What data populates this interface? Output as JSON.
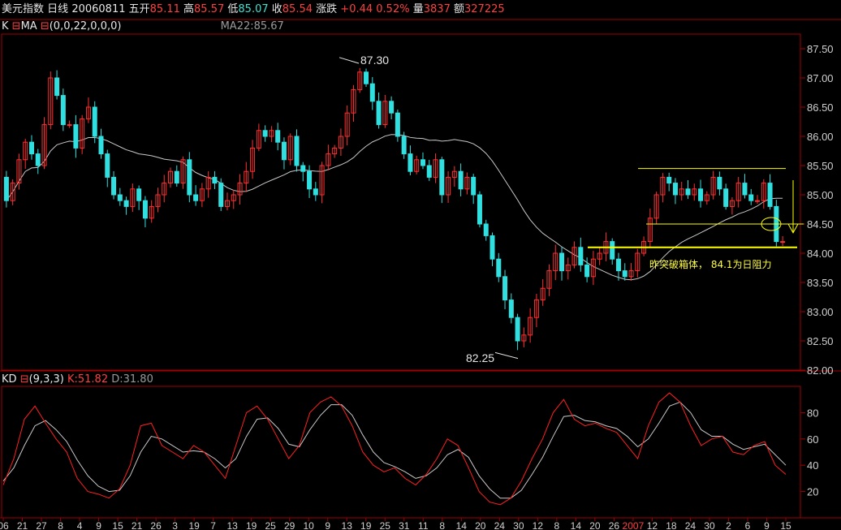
{
  "header": {
    "name": "美元指数",
    "period": "日线",
    "date": "20060811",
    "weekday": "五",
    "open_label": "开",
    "open": "85.11",
    "high_label": "高",
    "high": "85.57",
    "low_label": "低",
    "low": "85.07",
    "close_label": "收",
    "close": "85.54",
    "change_label": "涨跌",
    "change": "+0.44",
    "change_pct": "0.52%",
    "volume_label": "量",
    "volume": "3837",
    "amount_label": "额",
    "amount": "327225"
  },
  "main_panel": {
    "indicator": "K",
    "indicator_marker": "⊟",
    "ma_label": "MA",
    "ma_params": "(0,0,22,0,0,0)",
    "ma_value": "MA22:85.67",
    "y_ticks": [
      "87.50",
      "87.00",
      "86.50",
      "86.00",
      "85.50",
      "85.00",
      "84.50",
      "84.00",
      "83.50",
      "83.00",
      "82.50",
      "82.00"
    ],
    "annotation_high": "87.30",
    "annotation_low": "82.25",
    "annotation_note": "昨突破箱体， 84.1为日阻力",
    "colors": {
      "up": "#ff3030",
      "down": "#30e0e0",
      "ma": "#c8c8c8",
      "line": "#ffff00"
    }
  },
  "kd_panel": {
    "title": "KD",
    "marker": "⊟",
    "params": "(9,3,3)",
    "k_value": "K:51.82",
    "d_value": "D:31.80",
    "y_ticks": [
      "80",
      "60",
      "40",
      "20"
    ]
  },
  "x_axis": {
    "labels": [
      "06",
      "21",
      "27",
      "8",
      "4",
      "9",
      "15",
      "21",
      "26",
      "3",
      "19",
      "7",
      "13",
      "19",
      "25",
      "29",
      "10",
      "9",
      "13",
      "19",
      "25",
      "31",
      "11",
      "8",
      "14",
      "20",
      "24",
      "30",
      "12",
      "8",
      "14",
      "20",
      "26",
      "2007",
      "12",
      "18",
      "24",
      "30",
      "2",
      "6",
      "9",
      "15"
    ]
  },
  "chart_data": {
    "type": "candlestick",
    "ylim": [
      82.0,
      87.75
    ],
    "opens": [
      85.3,
      84.9,
      85.2,
      85.6,
      85.9,
      85.7,
      85.5,
      86.2,
      87.0,
      86.7,
      86.2,
      86.2,
      85.8,
      86.3,
      86.5,
      86.0,
      85.7,
      85.3,
      85.0,
      84.9,
      84.8,
      85.1,
      84.9,
      84.6,
      84.8,
      85.0,
      85.2,
      85.4,
      85.2,
      85.6,
      85.0,
      84.9,
      85.1,
      85.3,
      85.2,
      84.8,
      84.9,
      85.0,
      85.2,
      85.4,
      85.8,
      86.1,
      86.0,
      86.1,
      85.9,
      85.6,
      86.0,
      85.5,
      85.4,
      85.1,
      85.0,
      85.5,
      85.7,
      85.8,
      86.0,
      86.4,
      86.8,
      87.1,
      86.9,
      86.6,
      86.2,
      86.6,
      86.4,
      86.0,
      85.7,
      85.4,
      85.6,
      85.5,
      85.3,
      85.6,
      85.0,
      85.3,
      85.4,
      85.1,
      85.3,
      85.0,
      84.5,
      84.3,
      83.9,
      83.6,
      83.2,
      82.9,
      82.5,
      82.6,
      82.9,
      83.2,
      83.4,
      83.7,
      84.0,
      83.7,
      83.8,
      84.1,
      83.8,
      83.6,
      83.9,
      84.0,
      84.2,
      83.9,
      83.7,
      83.6,
      83.7,
      84.0,
      84.2,
      84.6,
      85.0,
      85.3,
      85.2,
      85.0,
      85.1,
      85.0,
      85.1,
      84.9,
      85.0,
      85.3,
      85.1,
      84.8,
      84.9,
      85.2,
      85.0,
      84.9,
      84.9,
      85.2,
      84.8,
      84.2
    ],
    "closes": [
      84.9,
      85.2,
      85.6,
      85.9,
      85.7,
      85.5,
      86.2,
      87.0,
      86.7,
      86.2,
      86.2,
      85.8,
      86.3,
      86.5,
      86.0,
      85.7,
      85.3,
      85.0,
      84.9,
      84.8,
      85.1,
      84.9,
      84.6,
      84.8,
      85.0,
      85.2,
      85.4,
      85.2,
      85.6,
      85.0,
      84.9,
      85.1,
      85.3,
      85.2,
      84.8,
      84.9,
      85.0,
      85.2,
      85.4,
      85.8,
      86.1,
      86.0,
      86.1,
      85.9,
      85.6,
      86.0,
      85.5,
      85.4,
      85.1,
      85.0,
      85.5,
      85.7,
      85.8,
      86.0,
      86.4,
      86.8,
      87.1,
      86.9,
      86.6,
      86.2,
      86.6,
      86.4,
      86.0,
      85.7,
      85.4,
      85.6,
      85.5,
      85.3,
      85.6,
      85.0,
      85.3,
      85.4,
      85.1,
      85.3,
      85.0,
      84.5,
      84.3,
      83.9,
      83.6,
      83.2,
      82.9,
      82.5,
      82.6,
      82.9,
      83.2,
      83.4,
      83.7,
      84.0,
      83.7,
      83.8,
      84.1,
      83.8,
      83.6,
      83.9,
      84.0,
      84.2,
      83.9,
      83.7,
      83.6,
      83.7,
      84.0,
      84.2,
      84.6,
      85.0,
      85.3,
      85.2,
      85.0,
      85.1,
      85.0,
      85.1,
      84.9,
      85.0,
      85.3,
      85.1,
      84.8,
      84.9,
      85.2,
      85.0,
      84.9,
      84.9,
      85.2,
      84.8,
      84.2,
      84.2
    ],
    "high_extreme": 87.3,
    "low_extreme": 82.25,
    "resistance": 84.1,
    "box_top": 85.45,
    "box_bottom": 84.5,
    "kd_k": [
      25,
      45,
      75,
      85,
      72,
      60,
      50,
      30,
      20,
      18,
      15,
      22,
      40,
      70,
      72,
      55,
      50,
      45,
      55,
      50,
      40,
      30,
      55,
      80,
      85,
      75,
      60,
      45,
      55,
      80,
      88,
      92,
      85,
      70,
      50,
      40,
      35,
      38,
      30,
      25,
      33,
      45,
      60,
      55,
      38,
      20,
      12,
      10,
      15,
      28,
      45,
      60,
      80,
      90,
      75,
      70,
      72,
      68,
      65,
      55,
      45,
      70,
      88,
      95,
      88,
      70,
      55,
      60,
      62,
      50,
      48,
      55,
      58,
      40,
      33
    ],
    "kd_d": [
      28,
      38,
      55,
      70,
      74,
      67,
      58,
      44,
      32,
      24,
      20,
      21,
      32,
      50,
      62,
      60,
      55,
      50,
      51,
      50,
      45,
      38,
      45,
      62,
      75,
      76,
      68,
      56,
      54,
      67,
      78,
      86,
      86,
      78,
      63,
      50,
      42,
      39,
      35,
      30,
      32,
      38,
      48,
      52,
      46,
      32,
      22,
      15,
      15,
      21,
      33,
      46,
      62,
      77,
      78,
      74,
      73,
      70,
      68,
      62,
      54,
      60,
      72,
      85,
      88,
      80,
      67,
      62,
      62,
      56,
      52,
      54,
      56,
      48,
      40
    ]
  }
}
